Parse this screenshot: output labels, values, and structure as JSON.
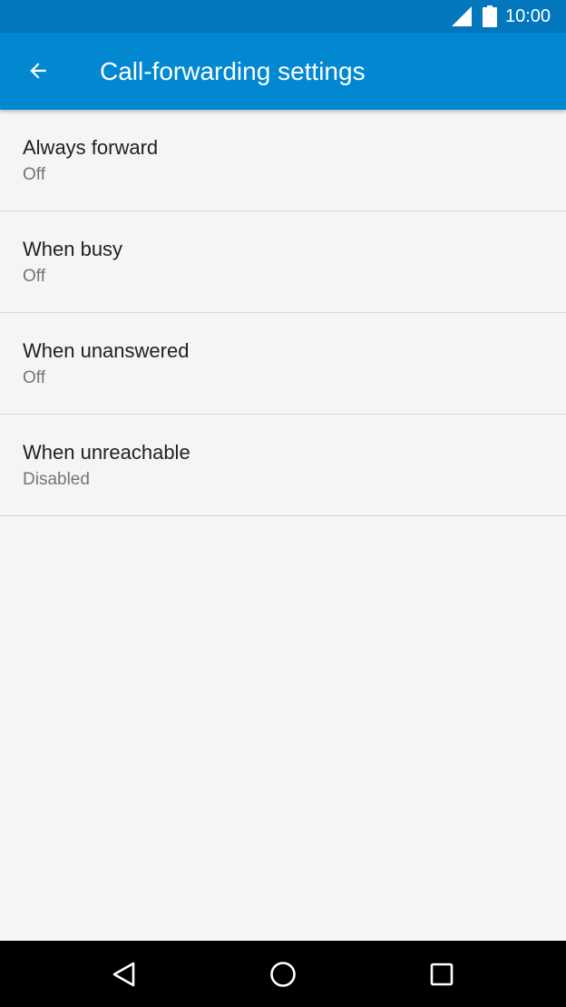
{
  "status_bar": {
    "time": "10:00",
    "icons": [
      "signal-icon",
      "battery-icon"
    ]
  },
  "app_bar": {
    "back_icon": "arrow-back-icon",
    "title": "Call-forwarding settings"
  },
  "settings": [
    {
      "label": "Always forward",
      "value": "Off"
    },
    {
      "label": "When busy",
      "value": "Off"
    },
    {
      "label": "When unanswered",
      "value": "Off"
    },
    {
      "label": "When unreachable",
      "value": "Disabled"
    }
  ],
  "nav_bar": {
    "icons": [
      "nav-back-icon",
      "nav-home-icon",
      "nav-recents-icon"
    ]
  },
  "colors": {
    "status_bar": "#0277bd",
    "app_bar": "#0288d1",
    "background": "#f5f5f5",
    "primary_text": "#212121",
    "secondary_text": "#757575",
    "divider": "#d6d6d6",
    "nav_bar": "#000000"
  }
}
